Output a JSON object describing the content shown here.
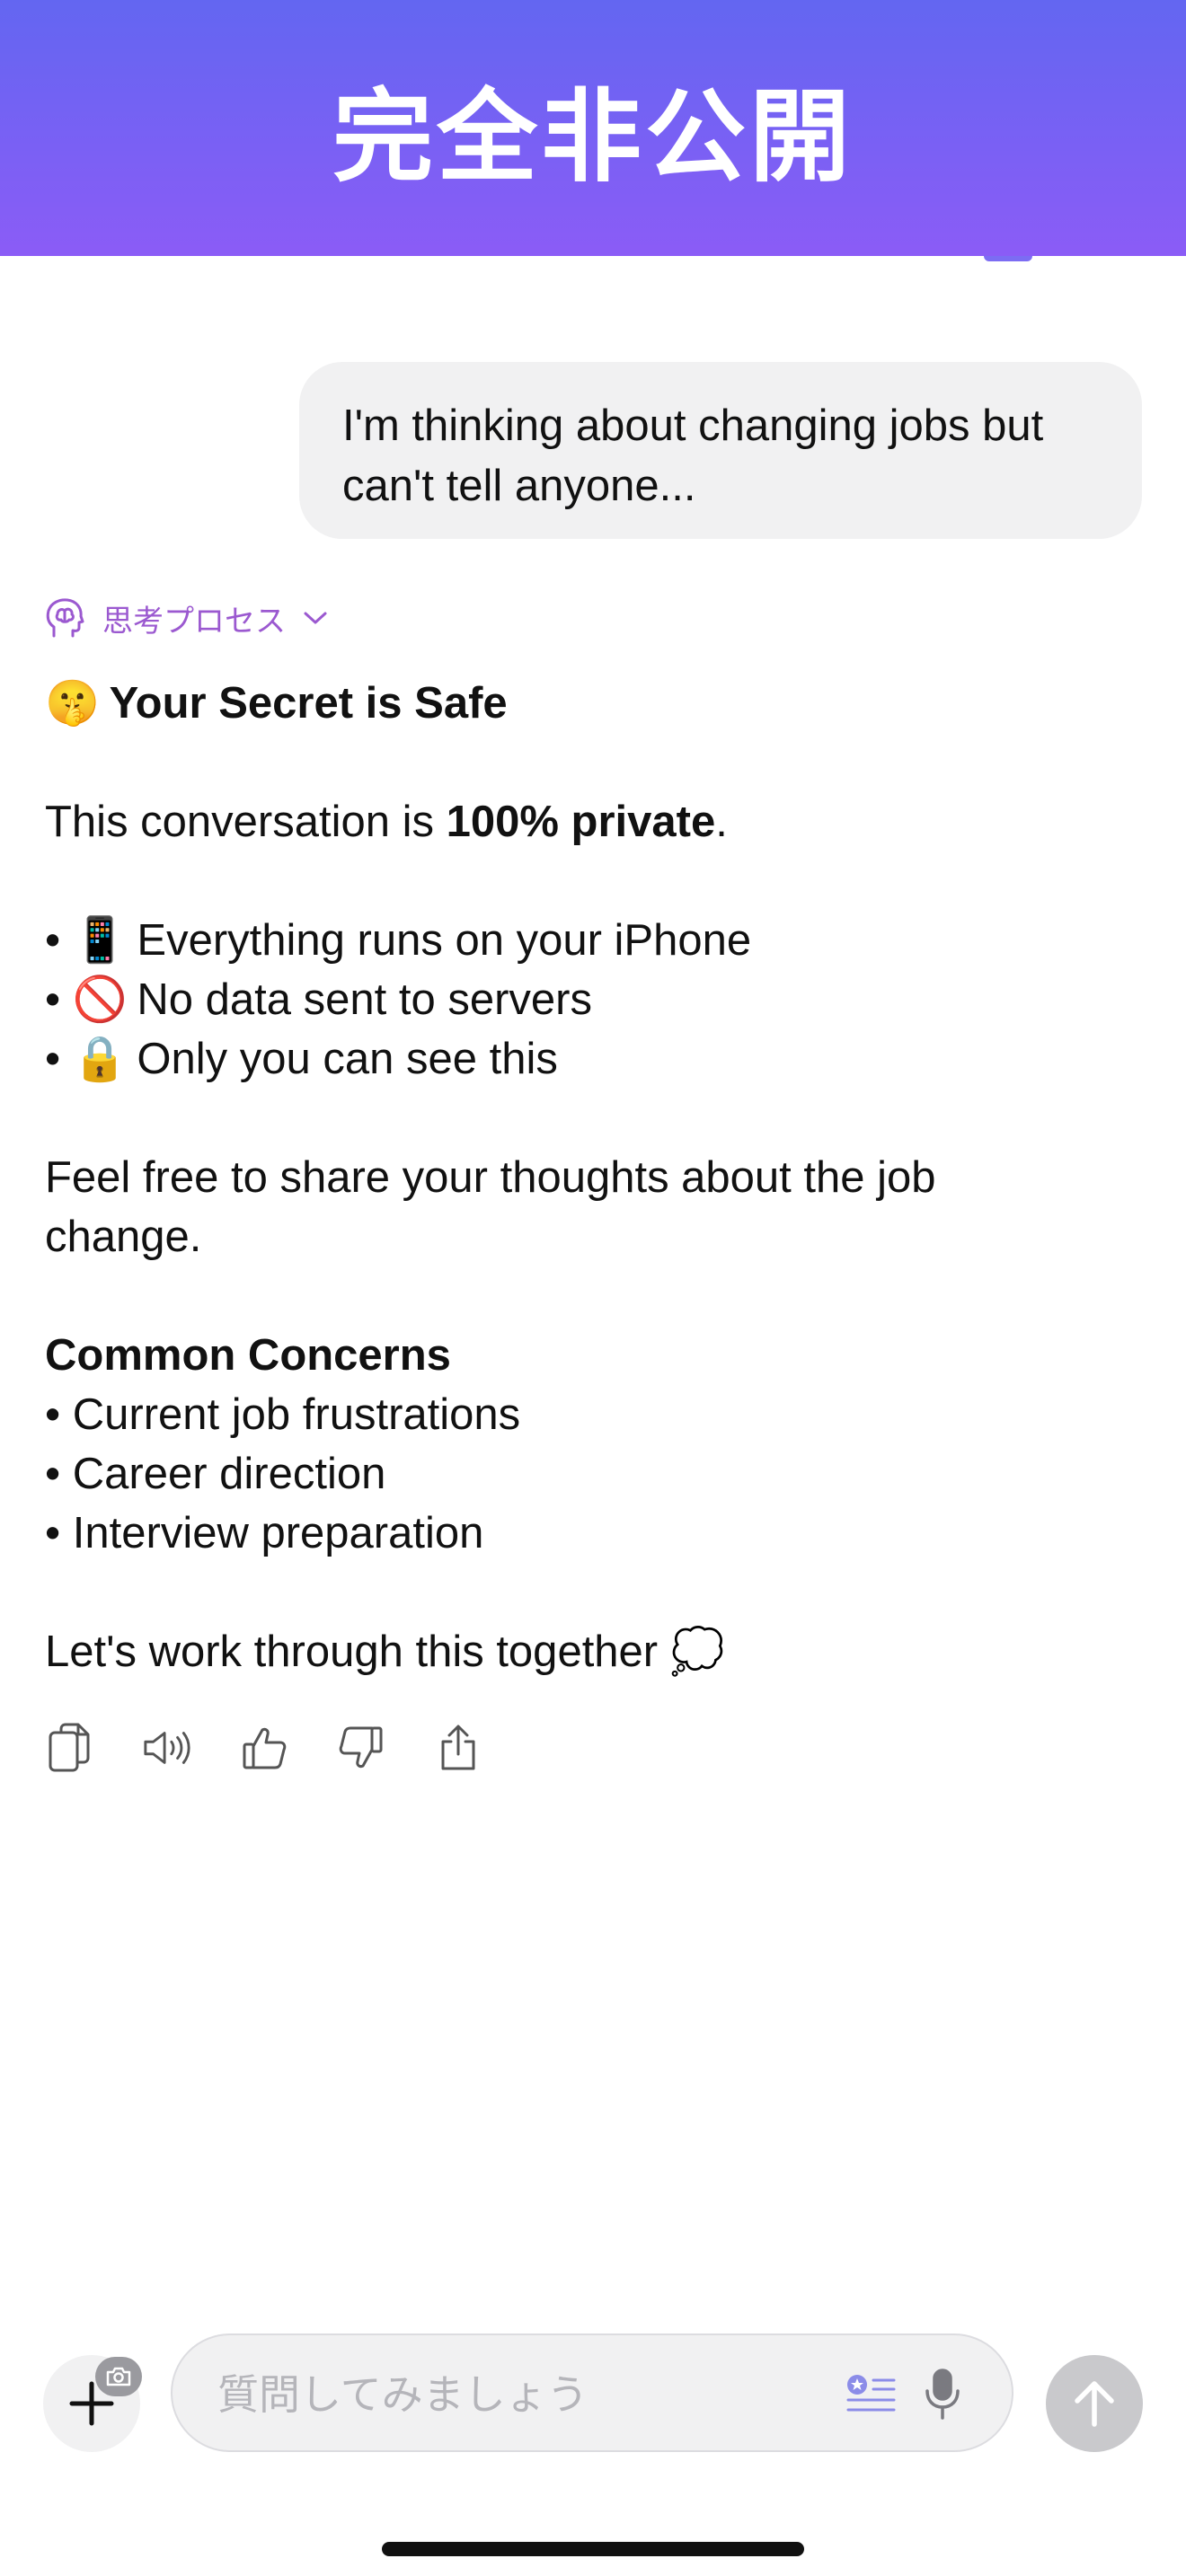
{
  "banner": {
    "title": "完全非公開"
  },
  "user_message": "I'm thinking about changing jobs but can't tell anyone...",
  "thinking": {
    "label": "思考プロセス"
  },
  "answer": {
    "heading_emoji": "🤫",
    "heading": "Your Secret is Safe",
    "intro_prefix": "This conversation is ",
    "intro_bold": "100% private",
    "intro_suffix": ".",
    "bullets": [
      {
        "emoji": "📱",
        "text": "Everything runs on your iPhone"
      },
      {
        "emoji": "🚫",
        "text": "No data sent to servers"
      },
      {
        "emoji": "🔒",
        "text": "Only you can see this"
      }
    ],
    "share_line1": "Feel free to share your thoughts about the job",
    "share_line2": "change.",
    "concerns_heading": "Common Concerns",
    "concerns": [
      "Current job frustrations",
      "Career direction",
      "Interview preparation"
    ],
    "closing": "Let's work through this together",
    "closing_emoji": "💭"
  },
  "actions": [
    "copy-icon",
    "speaker-icon",
    "thumbs-up-icon",
    "thumbs-down-icon",
    "share-icon"
  ],
  "composer": {
    "placeholder": "質問してみましょう"
  },
  "colors": {
    "banner_top": "#6366f1",
    "banner_bottom": "#8b5cf6",
    "thinking_accent": "#9b59d0",
    "bubble_bg": "#f1f1f2"
  }
}
